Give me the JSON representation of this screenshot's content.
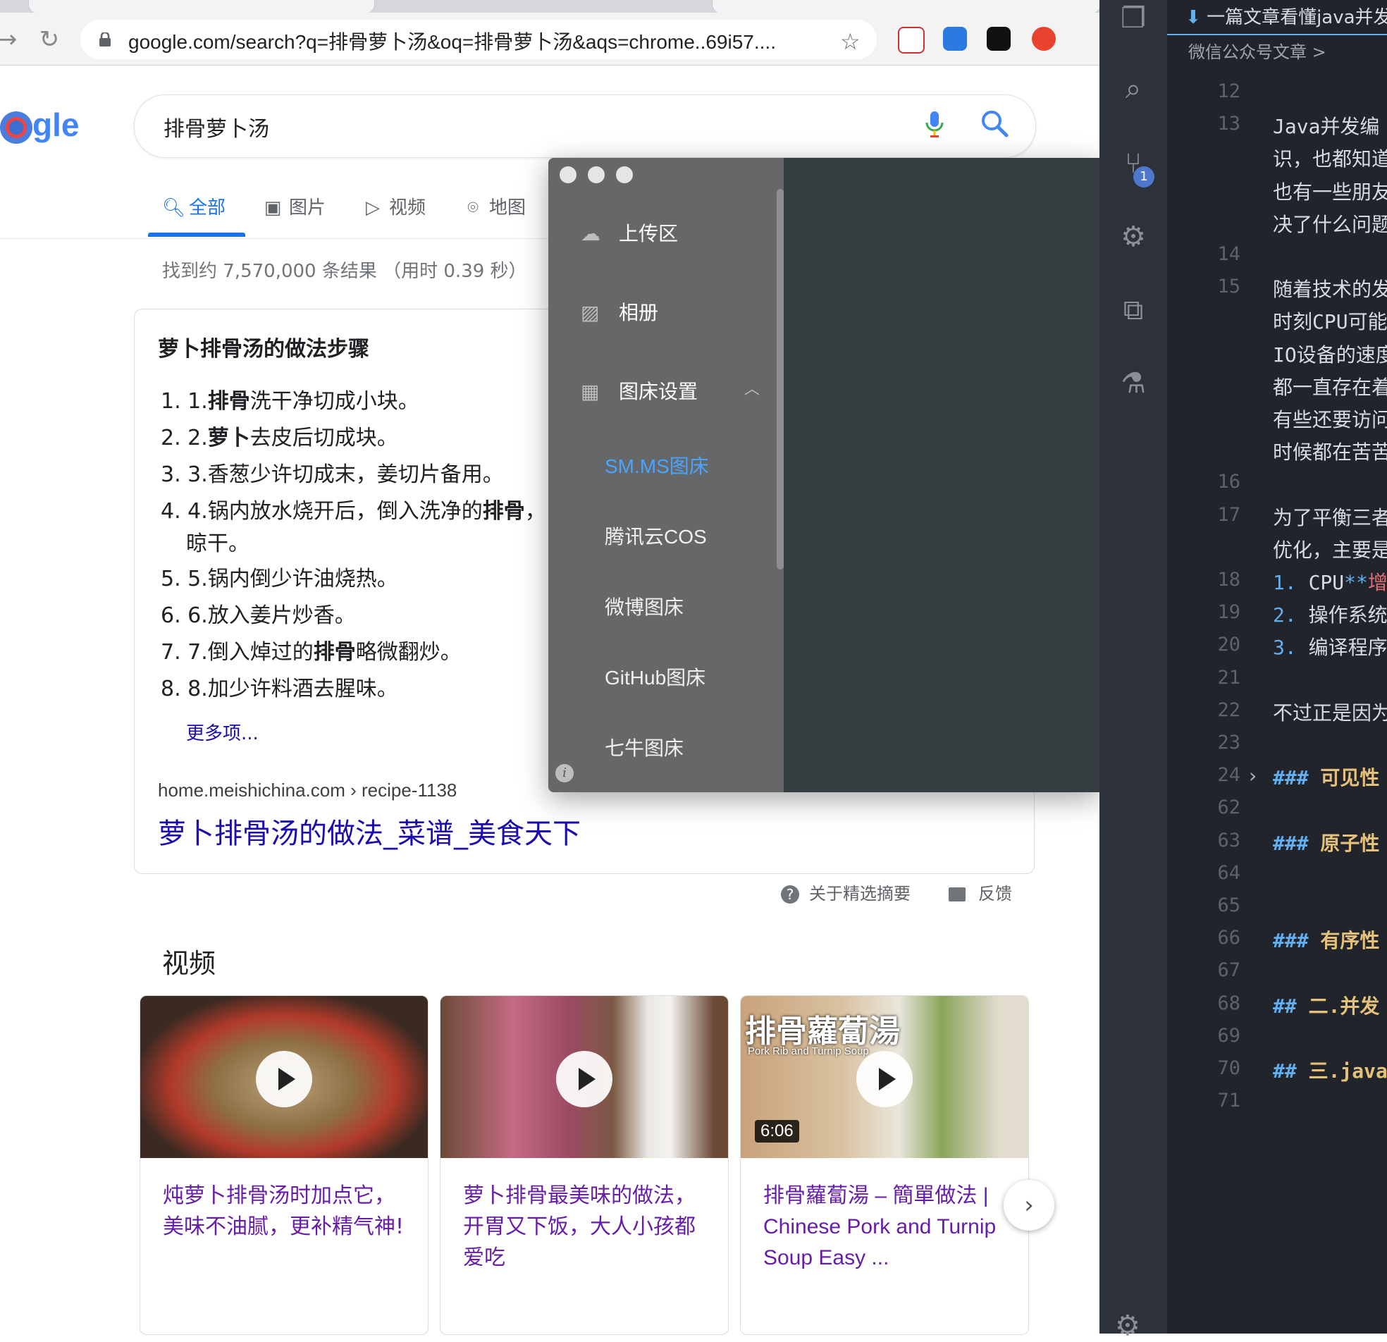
{
  "browser": {
    "url": "google.com/search?q=排骨萝卜汤&oq=排骨萝卜汤&aqs=chrome..69i57...."
  },
  "search": {
    "logo": "gle",
    "query": "排骨萝卜汤",
    "tabs": [
      "全部",
      "图片",
      "视频",
      "地图"
    ],
    "result_stats": "找到约 7,570,000 条结果  （用时 0.39 秒）"
  },
  "snippet": {
    "title": "萝卜排骨汤的做法步骤",
    "steps": [
      {
        "num": "1. ",
        "pre": "1.",
        "bold": "排骨",
        "post": "洗干净切成小块。"
      },
      {
        "num": "2. ",
        "pre": "2.",
        "bold": "萝卜",
        "post": "去皮后切成块。"
      },
      {
        "num": "3. ",
        "pre": "3.香葱少许切成末，姜切片备用。",
        "bold": "",
        "post": ""
      },
      {
        "num": "4. ",
        "pre": "4.锅内放水烧开后，倒入洗净的",
        "bold": "排骨",
        "post": "，"
      },
      {
        "num": "",
        "pre": "晾干。",
        "bold": "",
        "post": ""
      },
      {
        "num": "5. ",
        "pre": "5.锅内倒少许油烧热。",
        "bold": "",
        "post": ""
      },
      {
        "num": "6. ",
        "pre": "6.放入姜片炒香。",
        "bold": "",
        "post": ""
      },
      {
        "num": "7. ",
        "pre": "7.倒入焯过的",
        "bold": "排骨",
        "post": "略微翻炒。"
      },
      {
        "num": "8. ",
        "pre": "8.加少许料酒去腥味。",
        "bold": "",
        "post": ""
      }
    ],
    "more": "更多项...",
    "breadcrumb": "home.meishichina.com › recipe-1138",
    "link": "萝卜排骨汤的做法_菜谱_美食天下",
    "about": "关于精选摘要",
    "feedback": "反馈"
  },
  "videos": {
    "heading": "视频",
    "items": [
      {
        "title": "炖萝卜排骨汤时加点它，美味不油腻，更补精气神!"
      },
      {
        "title": "萝卜排骨最美味的做法，开胃又下饭，大人小孩都爱吃"
      },
      {
        "title": "排骨蘿蔔湯 – 簡單做法 | Chinese Pork and Turnip Soup Easy ...",
        "duration": "6:06",
        "thumb_text": "排骨蘿蔔湯",
        "thumb_sub": "Pork Rib and Turnip Soup"
      }
    ]
  },
  "picgo": {
    "menu": [
      {
        "label": "上传区",
        "icon": "cloud-upload-icon"
      },
      {
        "label": "相册",
        "icon": "image-icon"
      },
      {
        "label": "图床设置",
        "icon": "grid-icon"
      }
    ],
    "submenu": [
      "SM.MS图床",
      "腾讯云COS",
      "微博图床",
      "GitHub图床",
      "七牛图床"
    ],
    "active_submenu": "SM.MS图床"
  },
  "vscode": {
    "tab_title": "一篇文章看懂java并发",
    "breadcrumb": "微信公众号文章 > ",
    "lines": [
      {
        "n": "12",
        "t": ""
      },
      {
        "n": "13",
        "t": "Java并发编"
      },
      {
        "n": "",
        "t": "识，也都知道"
      },
      {
        "n": "",
        "t": "也有一些朋友"
      },
      {
        "n": "",
        "t": "决了什么问题"
      },
      {
        "n": "14",
        "t": ""
      },
      {
        "n": "15",
        "t": "随着技术的发"
      },
      {
        "n": "",
        "t": "时刻CPU可能"
      },
      {
        "n": "",
        "t": "IO设备的速度"
      },
      {
        "n": "",
        "t": "都一直存在着"
      },
      {
        "n": "",
        "t": "有些还要访问"
      },
      {
        "n": "",
        "t": "时候都在苦苦"
      },
      {
        "n": "16",
        "t": ""
      },
      {
        "n": "17",
        "t": "为了平衡三者"
      },
      {
        "n": "",
        "t": "优化，主要是"
      },
      {
        "n": "18",
        "t": "1. CPU**增"
      },
      {
        "n": "19",
        "t": "2. 操作系统"
      },
      {
        "n": "20",
        "t": "3. 编译程序"
      },
      {
        "n": "21",
        "t": ""
      },
      {
        "n": "22",
        "t": "不过正是因为"
      },
      {
        "n": "23",
        "t": ""
      },
      {
        "n": "24",
        "t": "### 可见性"
      },
      {
        "n": "62",
        "t": ""
      },
      {
        "n": "63",
        "t": "### 原子性"
      },
      {
        "n": "64",
        "t": ""
      },
      {
        "n": "65",
        "t": ""
      },
      {
        "n": "66",
        "t": "### 有序性"
      },
      {
        "n": "67",
        "t": ""
      },
      {
        "n": "68",
        "t": "## 二.并发"
      },
      {
        "n": "69",
        "t": ""
      },
      {
        "n": "70",
        "t": "## 三.java"
      },
      {
        "n": "71",
        "t": ""
      }
    ],
    "scm_count": "1"
  }
}
